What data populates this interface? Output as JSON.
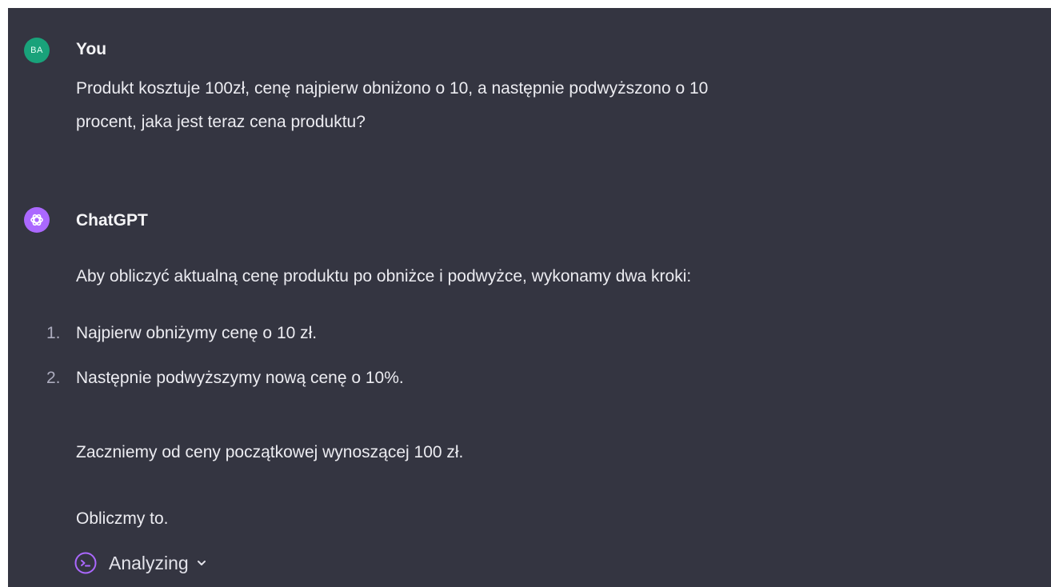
{
  "user_message": {
    "avatar_initials": "BA",
    "author": "You",
    "text_line1": "Produkt kosztuje 100zł, cenę najpierw obniżono o 10, a następnie podwyższono o 10",
    "text_line2": "procent, jaka jest teraz cena produktu?"
  },
  "assistant_message": {
    "avatar_icon": "openai-logo-icon",
    "author": "ChatGPT",
    "intro": "Aby obliczyć aktualną cenę produktu po obniżce i podwyżce, wykonamy dwa kroki:",
    "steps": [
      {
        "number": "1.",
        "text": "Najpierw obniżymy cenę o 10 zł."
      },
      {
        "number": "2.",
        "text": "Następnie podwyższymy nową cenę o 10%."
      }
    ],
    "paragraph2": "Zaczniemy od ceny początkowej wynoszącej 100 zł.",
    "paragraph3": "Obliczmy to.",
    "status": {
      "label": "Analyzing",
      "icon": "code-interpreter-spinner-icon",
      "toggle_icon": "chevron-down-icon"
    }
  },
  "colors": {
    "background": "#343541",
    "user_avatar": "#19a27a",
    "assistant_avatar": "#ab68ff",
    "spinner": "#ab68ff",
    "text": "#ececf1"
  }
}
